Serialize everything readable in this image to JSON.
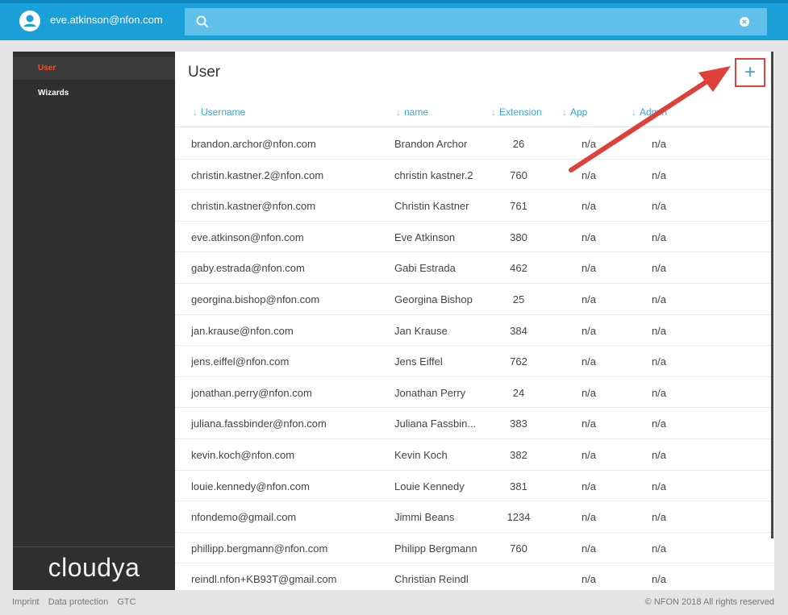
{
  "header": {
    "user_email": "eve.atkinson@nfon.com",
    "search_placeholder": ""
  },
  "sidebar": {
    "items": [
      {
        "label": "User",
        "active": true
      },
      {
        "label": "Wizards",
        "active": false
      }
    ],
    "logo": "cloudya"
  },
  "main": {
    "title": "User",
    "add_label": "+",
    "columns": [
      "Username",
      "name",
      "Extension",
      "App",
      "Admin"
    ],
    "rows": [
      {
        "username": "brandon.archor@nfon.com",
        "name": "Brandon Archor",
        "extension": "26",
        "app": "n/a",
        "admin": "n/a"
      },
      {
        "username": "christin.kastner.2@nfon.com",
        "name": "christin kastner.2",
        "extension": "760",
        "app": "n/a",
        "admin": "n/a"
      },
      {
        "username": "christin.kastner@nfon.com",
        "name": "Christin Kastner",
        "extension": "761",
        "app": "n/a",
        "admin": "n/a"
      },
      {
        "username": "eve.atkinson@nfon.com",
        "name": "Eve Atkinson",
        "extension": "380",
        "app": "n/a",
        "admin": "n/a"
      },
      {
        "username": "gaby.estrada@nfon.com",
        "name": "Gabi Estrada",
        "extension": "462",
        "app": "n/a",
        "admin": "n/a"
      },
      {
        "username": "georgina.bishop@nfon.com",
        "name": "Georgina Bishop",
        "extension": "25",
        "app": "n/a",
        "admin": "n/a"
      },
      {
        "username": "jan.krause@nfon.com",
        "name": "Jan Krause",
        "extension": "384",
        "app": "n/a",
        "admin": "n/a"
      },
      {
        "username": "jens.eiffel@nfon.com",
        "name": "Jens Eiffel",
        "extension": "762",
        "app": "n/a",
        "admin": "n/a"
      },
      {
        "username": "jonathan.perry@nfon.com",
        "name": "Jonathan Perry",
        "extension": "24",
        "app": "n/a",
        "admin": "n/a"
      },
      {
        "username": "juliana.fassbinder@nfon.com",
        "name": "Juliana Fassbin...",
        "extension": "383",
        "app": "n/a",
        "admin": "n/a"
      },
      {
        "username": "kevin.koch@nfon.com",
        "name": "Kevin Koch",
        "extension": "382",
        "app": "n/a",
        "admin": "n/a"
      },
      {
        "username": "louie.kennedy@nfon.com",
        "name": "Louie Kennedy",
        "extension": "381",
        "app": "n/a",
        "admin": "n/a"
      },
      {
        "username": "nfondemo@gmail.com",
        "name": "Jimmi Beans",
        "extension": "1234",
        "app": "n/a",
        "admin": "n/a"
      },
      {
        "username": "phillipp.bergmann@nfon.com",
        "name": "Philipp Bergmann",
        "extension": "760",
        "app": "n/a",
        "admin": "n/a"
      },
      {
        "username": "reindl.nfon+KB93T@gmail.com",
        "name": "Christian Reindl",
        "extension": "",
        "app": "n/a",
        "admin": "n/a"
      }
    ]
  },
  "footer": {
    "links": [
      "Imprint",
      "Data protection",
      "GTC"
    ],
    "copyright": "© NFON 2018 All rights reserved"
  },
  "colors": {
    "accent": "#1aa0d8",
    "active_nav": "#e8532c",
    "annotation": "#e04040"
  }
}
